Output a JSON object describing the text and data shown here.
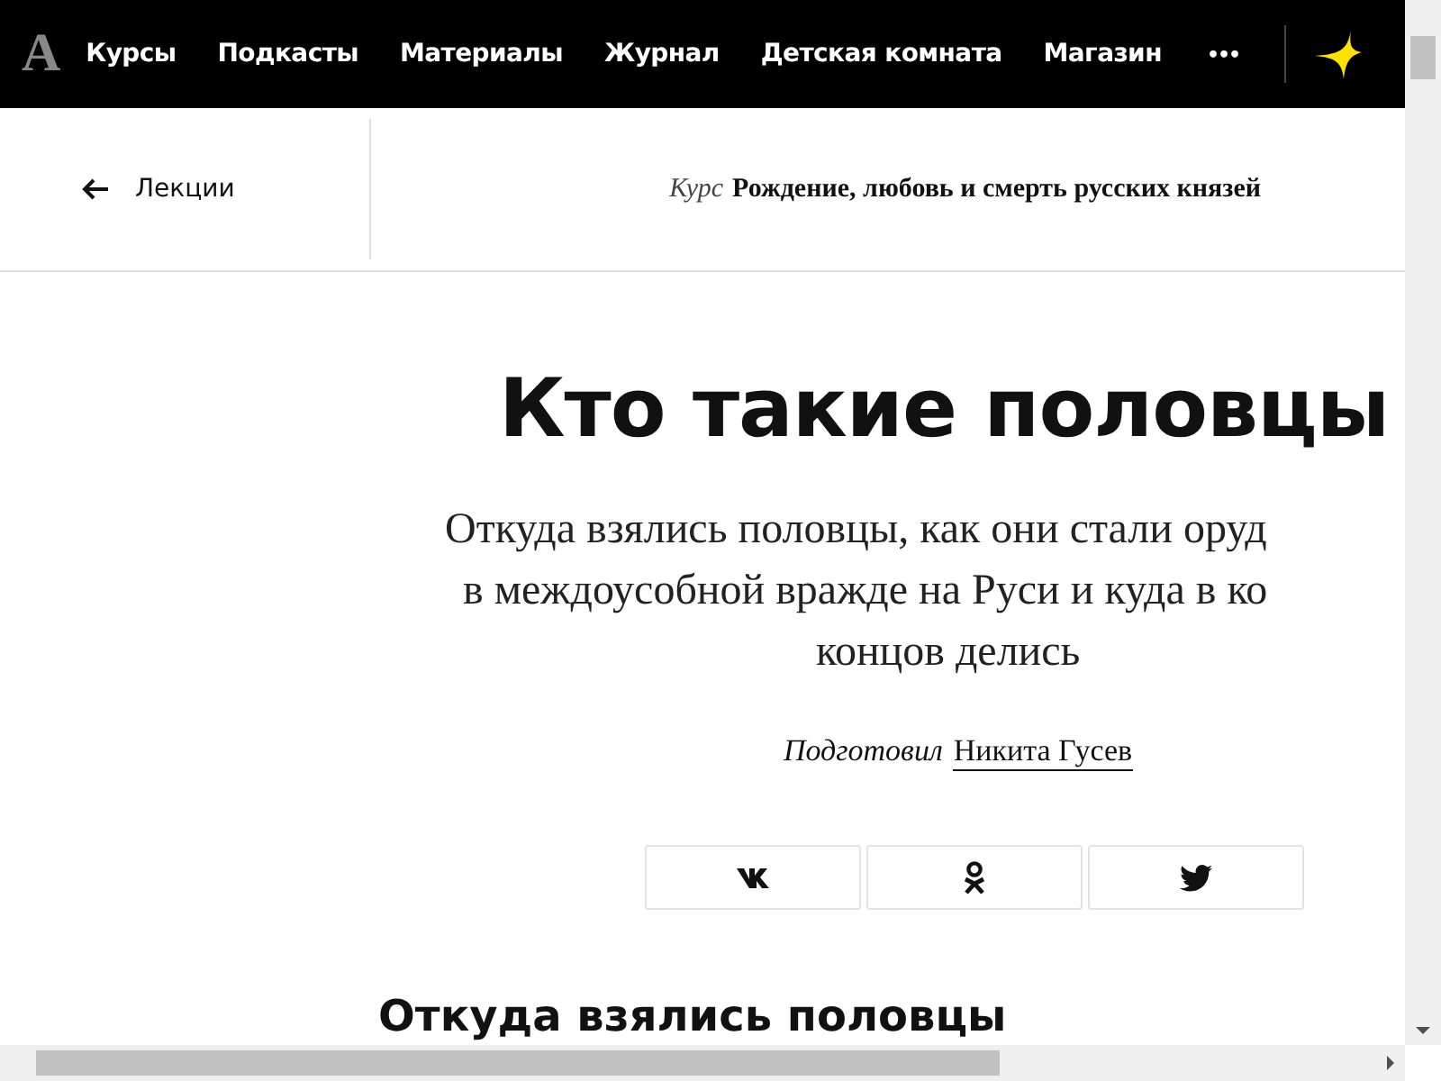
{
  "nav": {
    "logo": "А",
    "items": [
      {
        "label": "Курсы"
      },
      {
        "label": "Подкасты"
      },
      {
        "label": "Материалы"
      },
      {
        "label": "Журнал"
      },
      {
        "label": "Детская комната"
      },
      {
        "label": "Магазин"
      }
    ],
    "more": "•••"
  },
  "subheader": {
    "back": "Лекции",
    "course_label": "Курс",
    "course_title": "Рождение, любовь и смерть русских князей"
  },
  "article": {
    "title": "Кто такие половцы",
    "subtitle_lines": [
      "Откуда взялись половцы, как они стали оруд",
      "в междоусобной вражде на Руси и куда в ко",
      "концов делись"
    ],
    "byline_label": "Подготовил",
    "author": "Никита Гусев",
    "share": [
      {
        "kind": "vk"
      },
      {
        "kind": "ok"
      },
      {
        "kind": "twitter"
      }
    ],
    "section_heading": "Откуда взялись половцы"
  }
}
